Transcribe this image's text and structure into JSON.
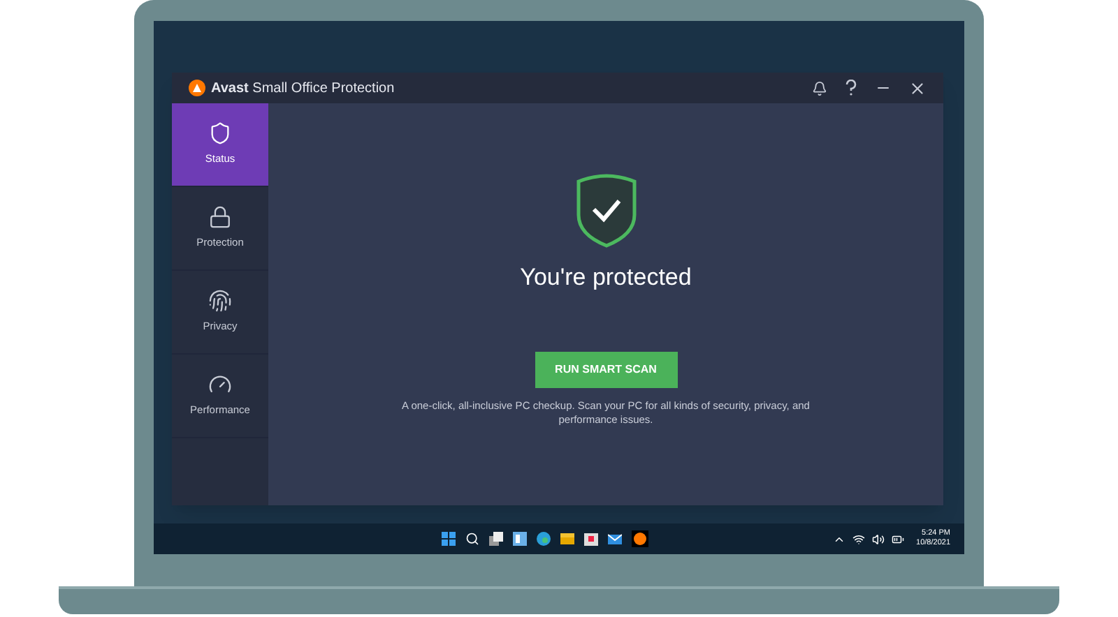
{
  "window": {
    "title": "**Avast** Small Office Protection"
  },
  "sidebar": {
    "items": [
      {
        "label": "Status",
        "kind": "shield",
        "selected": true
      },
      {
        "label": "Protection",
        "kind": "lock",
        "selected": false
      },
      {
        "label": "Privacy",
        "kind": "fingerprint",
        "selected": false
      },
      {
        "label": "Performance",
        "kind": "gauge",
        "selected": false
      }
    ]
  },
  "status": {
    "heading": "You're protected",
    "button": "RUN SMART SCAN",
    "description": "A one-click, all-inclusive PC checkup. Scan your PC for all kinds of security, privacy, and performance issues."
  },
  "taskbar": {
    "time": "5:24 PM",
    "date": "10/8/2021"
  }
}
